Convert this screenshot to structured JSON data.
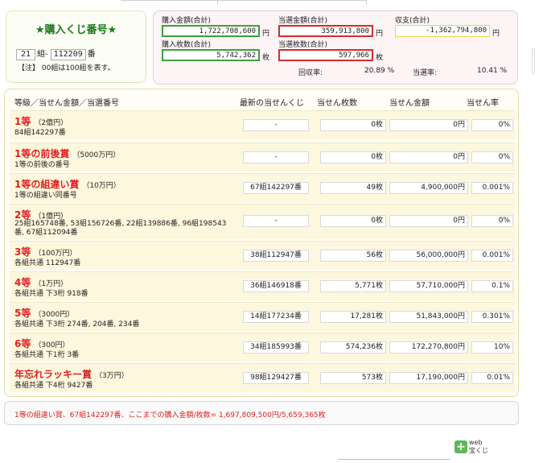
{
  "ticket": {
    "title": "★購入くじ番号★",
    "group": "21",
    "group_unit": "組-",
    "number": "112209",
    "number_unit": "番",
    "note": "【注】 00組は100組を表す。"
  },
  "summary": {
    "purchase_amount_label": "購入金額(合計)",
    "purchase_amount": "1,722,708,600",
    "purchase_amount_unit": "円",
    "winning_amount_label": "当選金額(合計)",
    "winning_amount": "359,913,800",
    "winning_amount_unit": "円",
    "balance_label": "収支(合計)",
    "balance": "-1,362,794,800",
    "balance_unit": "円",
    "purchase_count_label": "購入枚数(合計)",
    "purchase_count": "5,742,362",
    "purchase_count_unit": "枚",
    "winning_count_label": "当選枚数(合計)",
    "winning_count": "597,966",
    "winning_count_unit": "枚",
    "recovery_label": "回収率:",
    "recovery_value": "20.89 %",
    "winrate_label": "当選率:",
    "winrate_value": "10.41 %"
  },
  "colors": {
    "green": "#3e9e3e",
    "red": "#d62b2b",
    "yellow": "#e6dc33",
    "prize_red": "#e02020",
    "title_green": "#1a7a1a"
  },
  "table": {
    "headers": [
      "等級／当せん金額／当選番号",
      "最新の当せんくじ",
      "当せん枚数",
      "当せん金額",
      "当せん率"
    ],
    "rows": [
      {
        "name": "1等",
        "amount": "（2億円）",
        "sub": "84組142297番",
        "latest": "-",
        "count": "0枚",
        "money": "0円",
        "rate": "0%"
      },
      {
        "name": "1等の前後賞",
        "amount": "（5000万円）",
        "sub": "1等の前後の番号",
        "latest": "-",
        "count": "0枚",
        "money": "0円",
        "rate": "0%"
      },
      {
        "name": "1等の組違い賞",
        "amount": "（10万円）",
        "sub": "1等の組違い同番号",
        "latest": "67組142297番",
        "count": "49枚",
        "money": "4,900,000円",
        "rate": "0.001%"
      },
      {
        "name": "2等",
        "amount": "（1億円）",
        "sub": "25組165748番, 53組156726番, 22組139886番, 96組198543番, 67組112094番",
        "latest": "-",
        "count": "0枚",
        "money": "0円",
        "rate": "0%"
      },
      {
        "name": "3等",
        "amount": "（100万円）",
        "sub": "各組共通 112947番",
        "latest": "38組112947番",
        "count": "56枚",
        "money": "56,000,000円",
        "rate": "0.001%"
      },
      {
        "name": "4等",
        "amount": "（1万円）",
        "sub": "各組共通 下3桁 918番",
        "latest": "36組146918番",
        "count": "5,771枚",
        "money": "57,710,000円",
        "rate": "0.1%"
      },
      {
        "name": "5等",
        "amount": "（3000円）",
        "sub": "各組共通 下3桁 274番, 204番, 234番",
        "latest": "14組177234番",
        "count": "17,281枚",
        "money": "51,843,000円",
        "rate": "0.301%"
      },
      {
        "name": "6等",
        "amount": "（300円）",
        "sub": "各組共通 下1桁 3番",
        "latest": "34組185993番",
        "count": "574,236枚",
        "money": "172,270,800円",
        "rate": "10%"
      },
      {
        "name": "年忘れラッキー賞",
        "amount": "（3万円）",
        "sub": "各組共通 下4桁 9427番",
        "latest": "98組129427番",
        "count": "573枚",
        "money": "17,190,000円",
        "rate": "0.01%"
      }
    ]
  },
  "footer": "1等の組違い賞、67組142297番、ここまでの購入金額/枚数= 1,697,809,500円/5,659,365枚",
  "badge": {
    "line1": "web",
    "line2": "宝くじ"
  }
}
